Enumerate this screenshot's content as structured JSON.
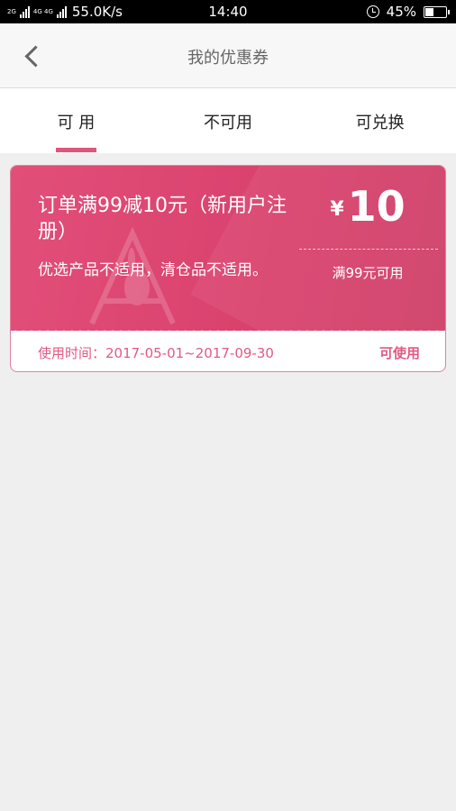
{
  "status_bar": {
    "net_left": "2G",
    "net_mid": "4G 4G",
    "speed": "55.0K/s",
    "time": "14:40",
    "battery_text": "45%",
    "battery_level": 0.45
  },
  "header": {
    "back_icon": "chevron-left-icon",
    "title": "我的优惠券"
  },
  "tabs": [
    {
      "label": "可 用",
      "active": true
    },
    {
      "label": "不可用",
      "active": false
    },
    {
      "label": "可兑换",
      "active": false
    }
  ],
  "coupon": {
    "title": "订单满99减10元（新用户注册）",
    "description": "优选产品不适用，清仓品不适用。",
    "currency": "¥",
    "amount": "10",
    "condition": "满99元可用",
    "validity": "使用时间：2017-05-01~2017-09-30",
    "status": "可使用"
  },
  "colors": {
    "accent": "#e0557d",
    "coupon_bg": "#d9416d",
    "page_bg": "#efefef"
  }
}
